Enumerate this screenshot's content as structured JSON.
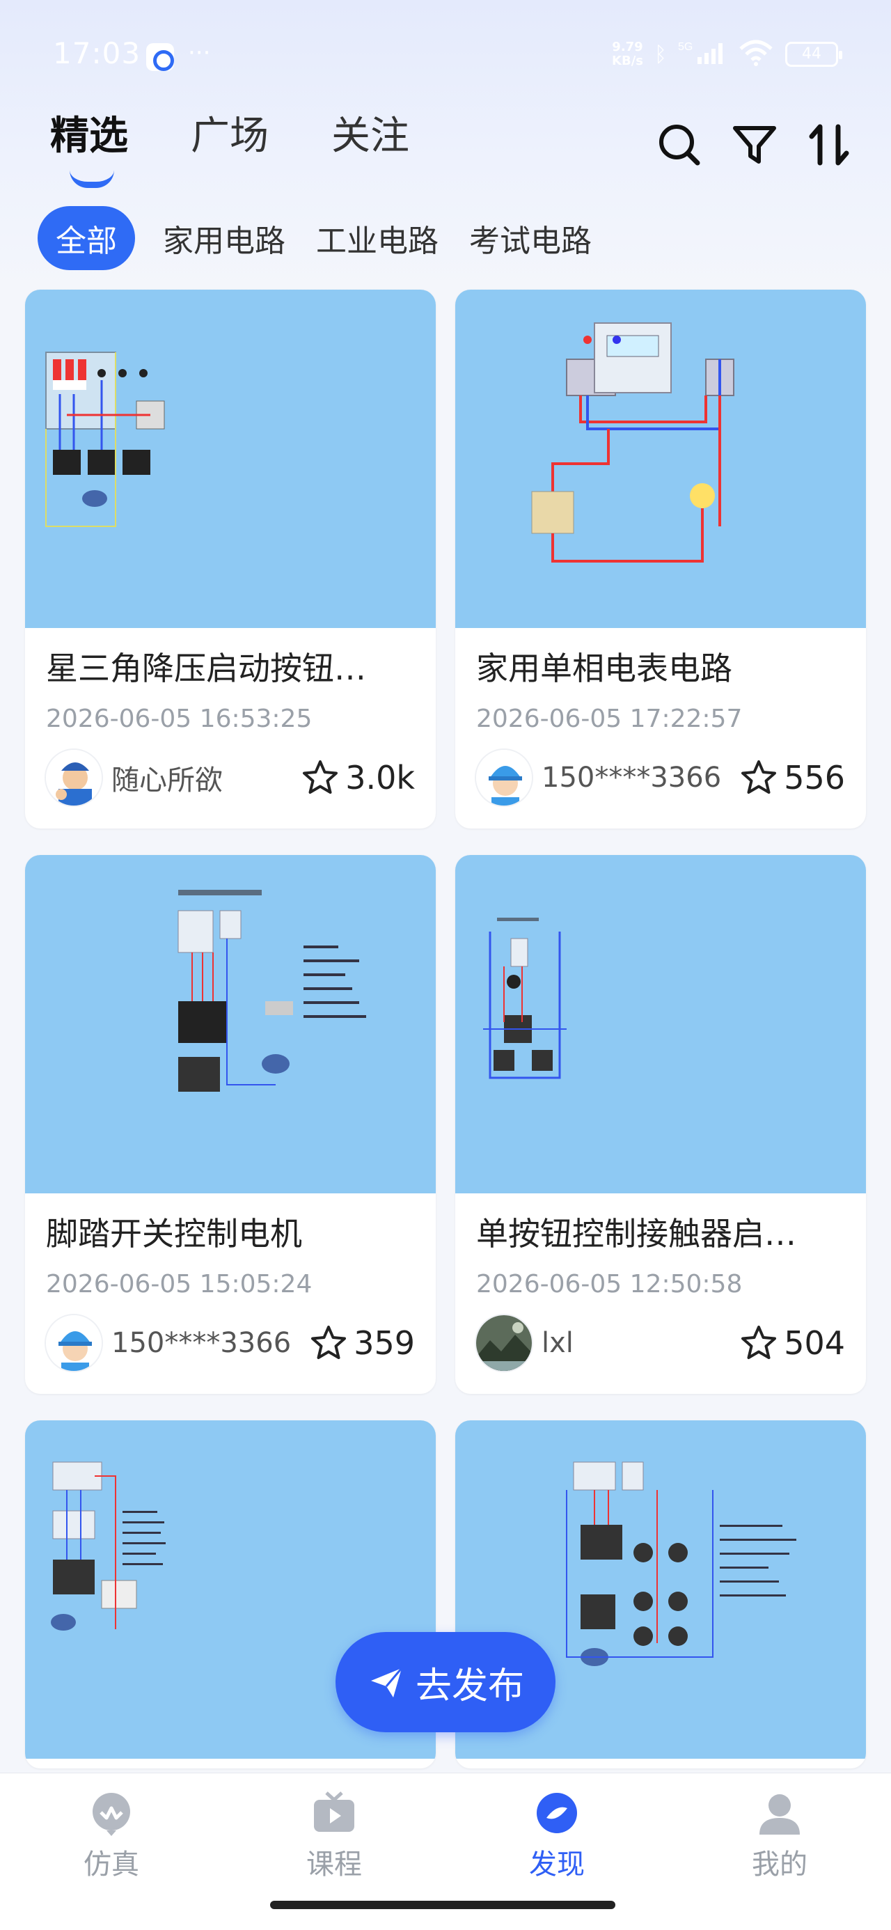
{
  "status_bar": {
    "time": "17:03",
    "net_speed_value": "9.79",
    "net_speed_unit": "KB/s",
    "network": "5G",
    "battery": "44"
  },
  "top_tabs": [
    {
      "label": "精选",
      "active": true
    },
    {
      "label": "广场",
      "active": false
    },
    {
      "label": "关注",
      "active": false
    }
  ],
  "filters": [
    {
      "label": "全部",
      "active": true
    },
    {
      "label": "家用电路",
      "active": false
    },
    {
      "label": "工业电路",
      "active": false
    },
    {
      "label": "考试电路",
      "active": false
    }
  ],
  "cards": [
    {
      "title": "星三角降压启动按钮…",
      "date": "2026-06-05 16:53:25",
      "author": "随心所欲",
      "likes": "3.0k",
      "avatar": "worker-avatar-icon"
    },
    {
      "title": "家用单相电表电路",
      "date": "2026-06-05 17:22:57",
      "author": "150****3366",
      "likes": "556",
      "avatar": "helmet-avatar-icon"
    },
    {
      "title": "脚踏开关控制电机",
      "date": "2026-06-05 15:05:24",
      "author": "150****3366",
      "likes": "359",
      "avatar": "helmet-avatar-icon"
    },
    {
      "title": "单按钮控制接触器启…",
      "date": "2026-06-05 12:50:58",
      "author": "lxl",
      "likes": "504",
      "avatar": "landscape-avatar-icon"
    }
  ],
  "fab": {
    "label": "去发布",
    "icon": "paper-plane-icon"
  },
  "bottom_nav": [
    {
      "label": "仿真",
      "icon": "simulation-icon",
      "active": false
    },
    {
      "label": "课程",
      "icon": "course-tv-icon",
      "active": false
    },
    {
      "label": "发现",
      "icon": "discover-icon",
      "active": true
    },
    {
      "label": "我的",
      "icon": "profile-icon",
      "active": false
    }
  ],
  "colors": {
    "accent": "#2f5ff5",
    "thumb_bg": "#8ec9f3",
    "inactive_text": "#9aa0a8"
  }
}
